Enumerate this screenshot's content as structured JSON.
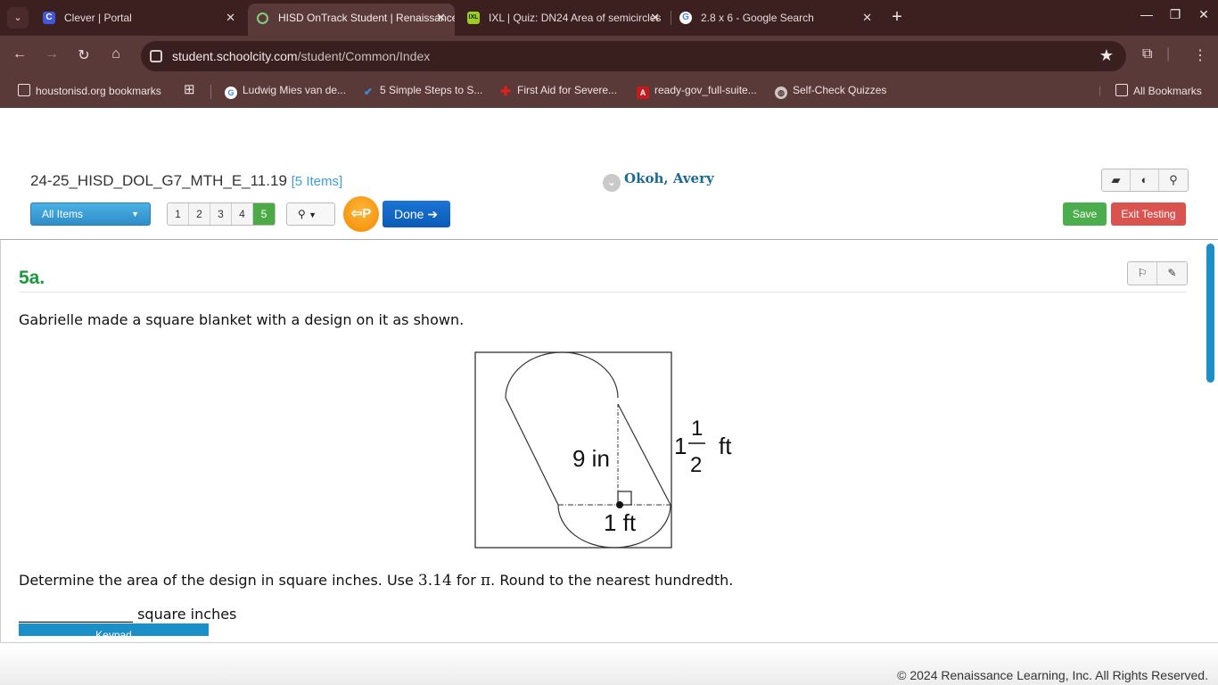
{
  "browser": {
    "tabs": [
      {
        "title": "Clever | Portal",
        "favicon": "clever-icon",
        "active": false
      },
      {
        "title": "HISD OnTrack Student | Renaissance",
        "favicon": "loading-icon",
        "active": true
      },
      {
        "title": "IXL | Quiz: DN24 Area of semicircles",
        "favicon": "ixl-icon",
        "active": false
      },
      {
        "title": "2.8 x 6 - Google Search",
        "favicon": "google-icon",
        "active": false
      }
    ],
    "url_host": "student.schoolcity.com",
    "url_path": "/student/Common/Index",
    "bookmarks": [
      {
        "label": "houstonisd.org bookmarks",
        "icon": "folder-icon"
      },
      {
        "label": "Ludwig Mies van de...",
        "icon": "google-icon"
      },
      {
        "label": "5 Simple Steps to S...",
        "icon": "check-icon"
      },
      {
        "label": "First Aid for Severe...",
        "icon": "red-cross-icon"
      },
      {
        "label": "ready-gov_full-suite...",
        "icon": "pdf-icon"
      },
      {
        "label": "Self-Check Quizzes",
        "icon": "globe-icon"
      }
    ],
    "all_bookmarks": "All Bookmarks"
  },
  "header": {
    "test_name": "24-25_HISD_DOL_G7_MTH_E_11.19",
    "item_count": "[5 Items]",
    "student_name": "Okoh, Avery",
    "all_items_label": "All Items",
    "pages": [
      "1",
      "2",
      "3",
      "4",
      "5"
    ],
    "current_page": "5",
    "p_label": "P",
    "done_label": "Done",
    "save_label": "Save",
    "exit_label": "Exit Testing"
  },
  "question": {
    "number": "5a.",
    "prompt": "Gabrielle made a square blanket with a design on it as shown.",
    "instruction_pre": "Determine the area of the design in square inches. Use ",
    "pi_value": "3.14",
    "instruction_mid": " for ",
    "pi_symbol": "π",
    "instruction_post": ". Round to the nearest hundredth.",
    "answer_blank": "________________",
    "answer_unit": " square inches",
    "keypad_label": "Keypad"
  },
  "figure": {
    "height_label": "9 in",
    "base_label": "1 ft",
    "side_whole": "1",
    "side_num": "1",
    "side_den": "2",
    "side_unit": "ft"
  },
  "footer": {
    "copyright": "© 2024 Renaissance Learning, Inc. All Rights Reserved."
  }
}
